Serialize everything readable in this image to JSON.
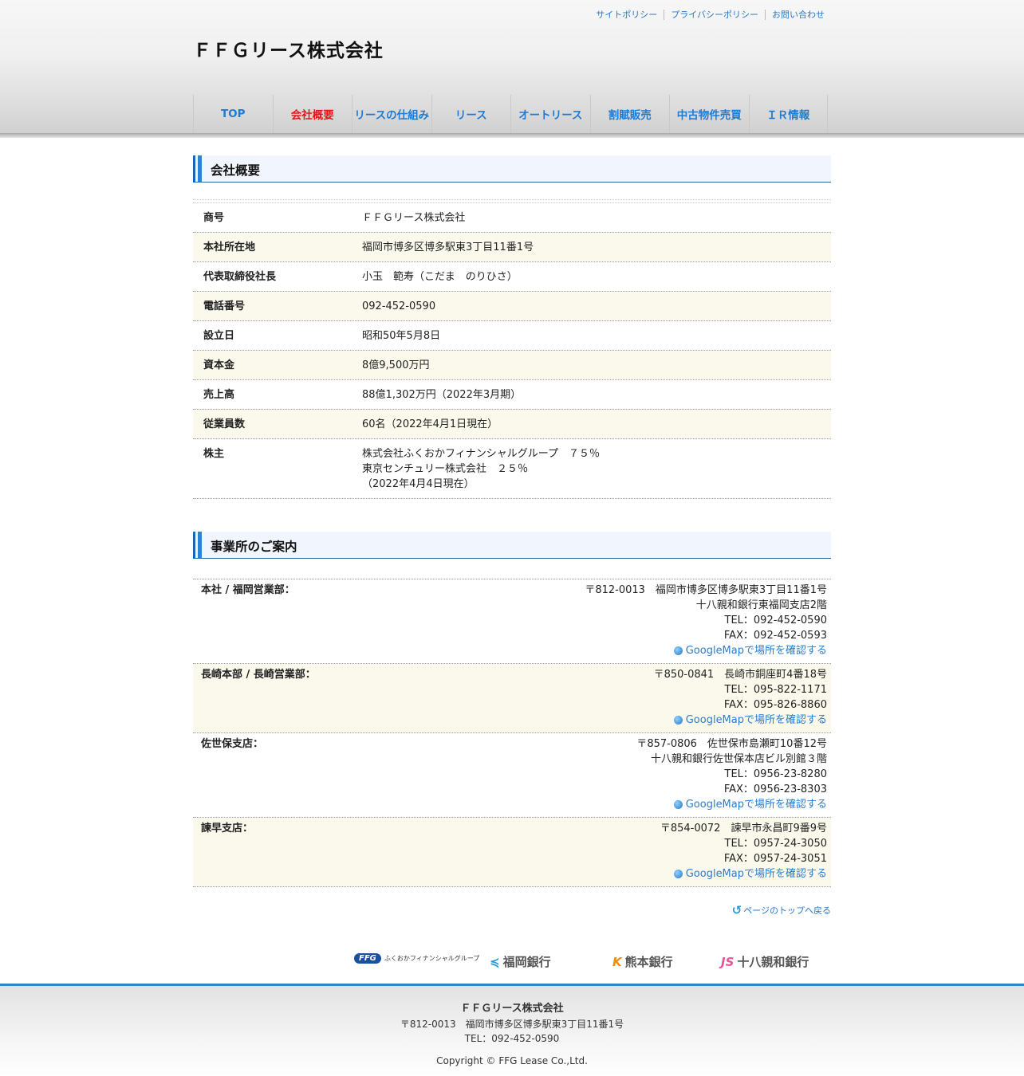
{
  "header": {
    "util_links": [
      "サイトポリシー",
      "プライバシーポリシー",
      "お問い合わせ"
    ],
    "site_title": "ＦＦＧリース株式会社",
    "nav": [
      "TOP",
      "会社概要",
      "リースの仕組み",
      "リース",
      "オートリース",
      "割賦販売",
      "中古物件売買",
      "ＩＲ情報"
    ],
    "active_nav": "会社概要",
    "colors": {
      "link": "#1d7bd4",
      "active": "#e8141b",
      "accent": "#2788cc"
    }
  },
  "company": {
    "heading": "会社概要",
    "rows": [
      {
        "label": "商号",
        "value": "ＦＦＧリース株式会社"
      },
      {
        "label": "本社所在地",
        "value": "福岡市博多区博多駅東3丁目11番1号"
      },
      {
        "label": "代表取締役社長",
        "value": "小玉　範寿（こだま　のりひさ）"
      },
      {
        "label": "電話番号",
        "value": "092-452-0590"
      },
      {
        "label": "設立日",
        "value": "昭和50年5月8日"
      },
      {
        "label": "資本金",
        "value": "8億9,500万円"
      },
      {
        "label": "売上高",
        "value": "88億1,302万円（2022年3月期）"
      },
      {
        "label": "従業員数",
        "value": "60名（2022年4月1日現在）"
      },
      {
        "label": "株主",
        "lines": [
          "株式会社ふくおかフィナンシャルグループ　７５％",
          "東京センチュリー株式会社　２５％",
          "（2022年4月4日現在）"
        ]
      }
    ]
  },
  "offices": {
    "heading": "事業所のご案内",
    "map_label": "GoogleMapで場所を確認する",
    "list": [
      {
        "name": "本社 / 福岡営業部：",
        "lines": [
          "〒812-0013　福岡市博多区博多駅東3丁目11番1号",
          "十八親和銀行東福岡支店2階",
          "TEL：092-452-0590",
          "FAX：092-452-0593"
        ]
      },
      {
        "name": "長崎本部 / 長崎営業部：",
        "lines": [
          "〒850-0841　長崎市銅座町4番18号",
          "TEL：095-822-1171",
          "FAX：095-826-8860"
        ]
      },
      {
        "name": "佐世保支店：",
        "lines": [
          "〒857-0806　佐世保市島瀬町10番12号",
          "十八親和銀行佐世保本店ビル別館３階",
          "TEL：0956-23-8280",
          "FAX：0956-23-8303"
        ]
      },
      {
        "name": "諫早支店：",
        "lines": [
          "〒854-0072　諫早市永昌町9番9号",
          "TEL：0957-24-3050",
          "FAX：0957-24-3051"
        ]
      }
    ]
  },
  "page_top": "ページのトップへ戻る",
  "logos": {
    "ffg_mark": "FFG",
    "ffg_text": "ふくおかフィナンシャルグループ",
    "fukuoka": "福岡銀行",
    "kumamoto": "熊本銀行",
    "juhachi": "十八親和銀行"
  },
  "footer": {
    "name": "ＦＦＧリース株式会社",
    "address": "〒812-0013　福岡市博多区博多駅東3丁目11番1号",
    "tel": "TEL：092-452-0590",
    "copyright": "Copyright © FFG Lease Co.,Ltd."
  }
}
